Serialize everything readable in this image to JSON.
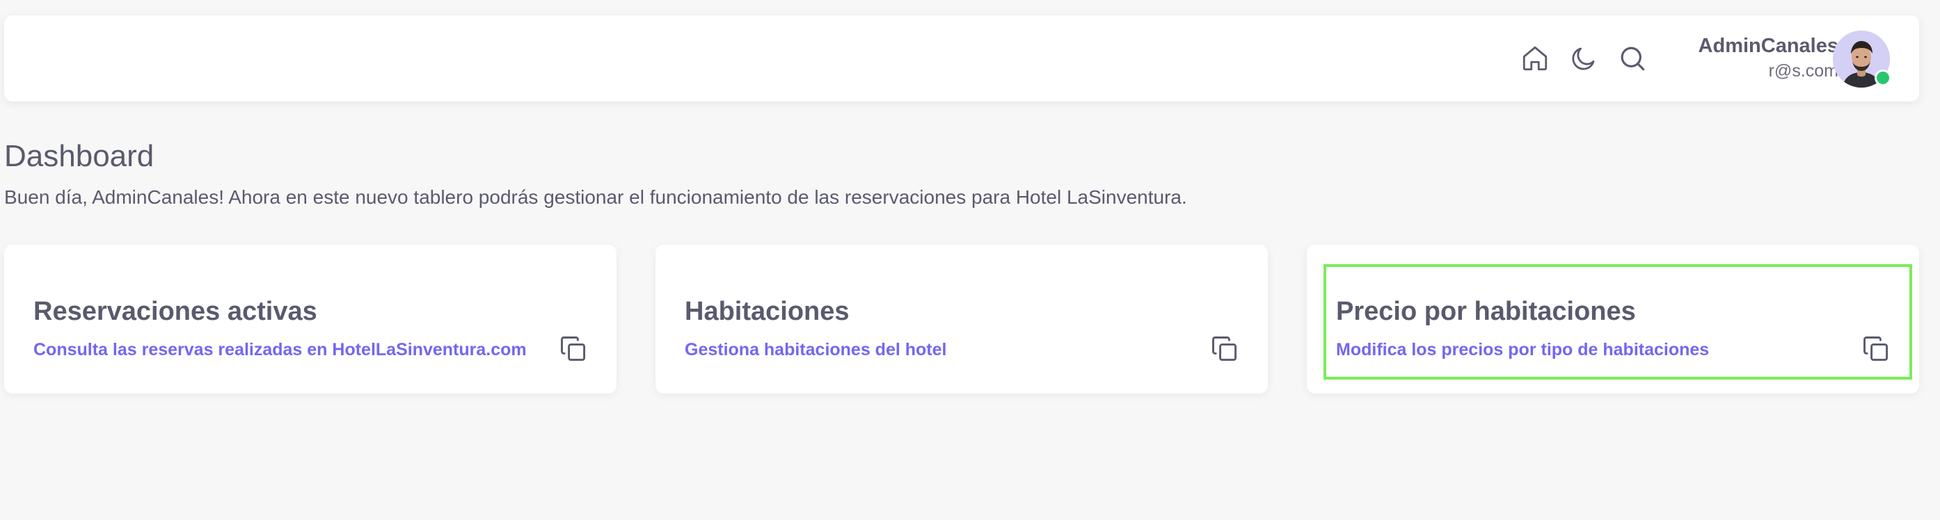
{
  "navbar": {
    "icons": [
      "home-icon",
      "moon-icon",
      "search-icon"
    ],
    "user": {
      "name": "AdminCanales",
      "email": "r@s.com",
      "status_color": "#28c76f"
    }
  },
  "page": {
    "title": "Dashboard",
    "subtitle": "Buen día, AdminCanales! Ahora en este nuevo tablero podrás gestionar el funcionamiento de las reservaciones para Hotel LaSinventura."
  },
  "cards": [
    {
      "title": "Reservaciones activas",
      "link": "Consulta las reservas realizadas en HotelLaSinventura.com",
      "icon": "copy-icon"
    },
    {
      "title": "Habitaciones",
      "link": "Gestiona habitaciones del hotel",
      "icon": "copy-icon"
    },
    {
      "title": "Precio por habitaciones",
      "link": "Modifica los precios por tipo de habitaciones",
      "icon": "copy-icon"
    }
  ],
  "colors": {
    "accent": "#7367f0",
    "text": "#5a5a6e",
    "background": "#f7f7f7",
    "highlight": "#7aeb5a"
  }
}
